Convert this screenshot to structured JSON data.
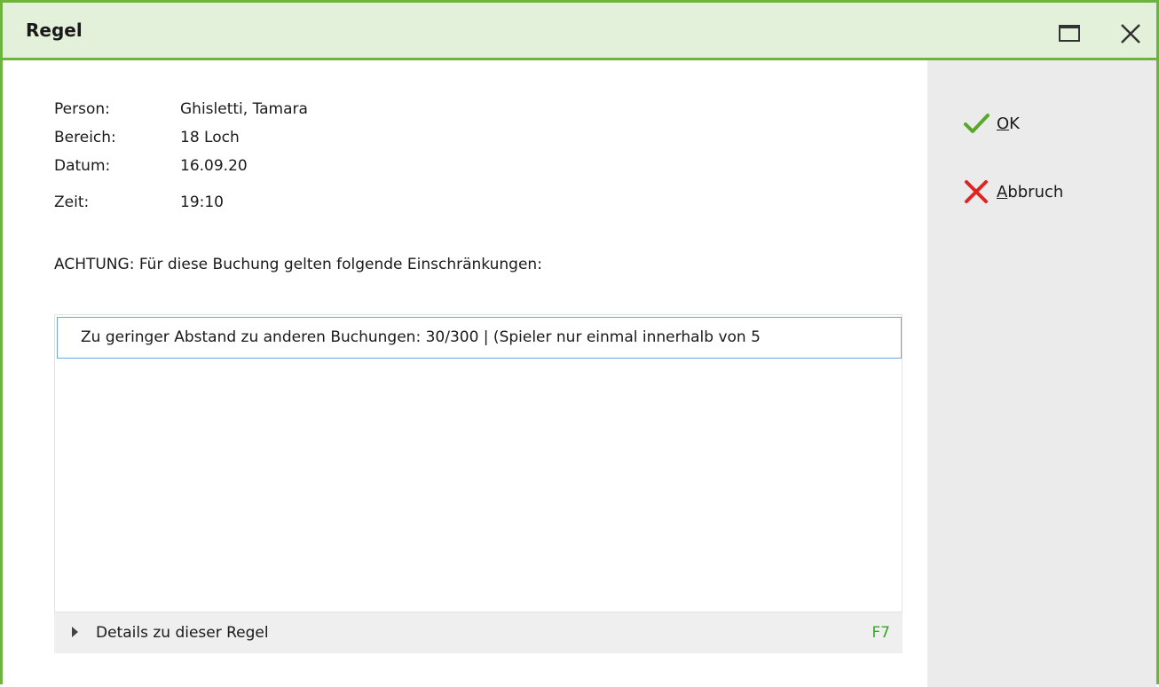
{
  "window": {
    "title": "Regel"
  },
  "info": [
    {
      "label": "Person:",
      "value": "Ghisletti, Tamara"
    },
    {
      "label": "Bereich:",
      "value": "18 Loch"
    },
    {
      "label": "Datum:",
      "value": "16.09.20"
    },
    {
      "label": "Zeit:",
      "value": "19:10"
    }
  ],
  "warning": "ACHTUNG: Für diese Buchung gelten folgende Einschränkungen:",
  "restrictions": [
    "Zu geringer Abstand zu anderen Buchungen: 30/300 | (Spieler nur einmal innerhalb von 5"
  ],
  "details": {
    "label": "Details zu dieser Regel",
    "shortcut": "F7"
  },
  "actions": {
    "ok": {
      "first": "O",
      "rest": "K"
    },
    "cancel": {
      "first": "A",
      "rest": "bbruch"
    }
  },
  "colors": {
    "accent": "#6db33f",
    "titlebar": "#e3f0da",
    "ok_icon": "#5aa82a",
    "cancel_icon": "#e02424",
    "selection_border": "#6da7e0",
    "shortcut": "#3aa32a"
  },
  "icons": {
    "maximize": "maximize-icon",
    "close": "close-icon",
    "ok": "checkmark-icon",
    "cancel": "x-icon",
    "expand": "triangle-right-icon"
  }
}
